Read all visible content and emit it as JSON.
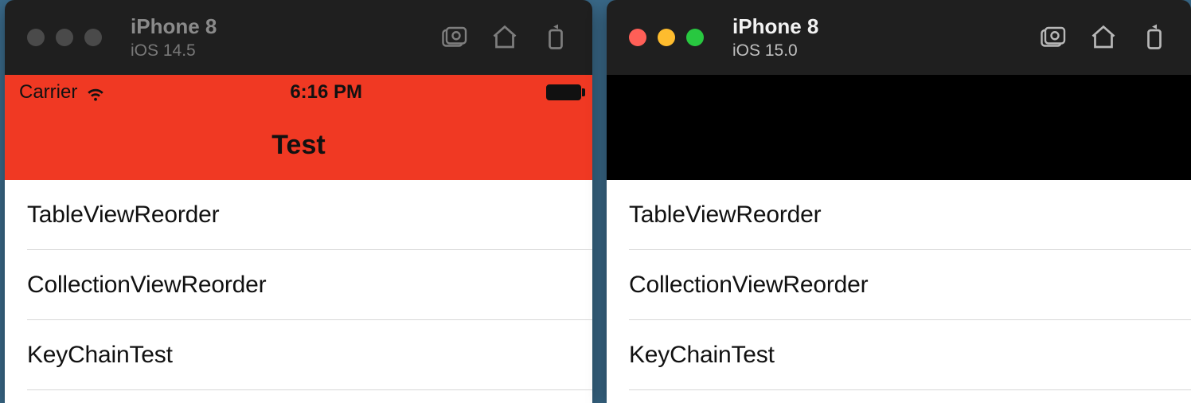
{
  "windows": {
    "left": {
      "traffic_active": false,
      "device": "iPhone 8",
      "os": "iOS 14.5"
    },
    "right": {
      "traffic_active": true,
      "device": "iPhone 8",
      "os": "iOS 15.0"
    }
  },
  "toolbar": {
    "screenshot_label": "Screenshot",
    "home_label": "Home",
    "rotate_label": "Rotate"
  },
  "statusbar": {
    "carrier": "Carrier",
    "time": "6:16 PM"
  },
  "nav": {
    "title": "Test"
  },
  "items": [
    {
      "label": "TableViewReorder"
    },
    {
      "label": "CollectionViewReorder"
    },
    {
      "label": "KeyChainTest"
    }
  ],
  "colors": {
    "navbar_ios14": "#f03923",
    "header_ios15": "#000000"
  }
}
